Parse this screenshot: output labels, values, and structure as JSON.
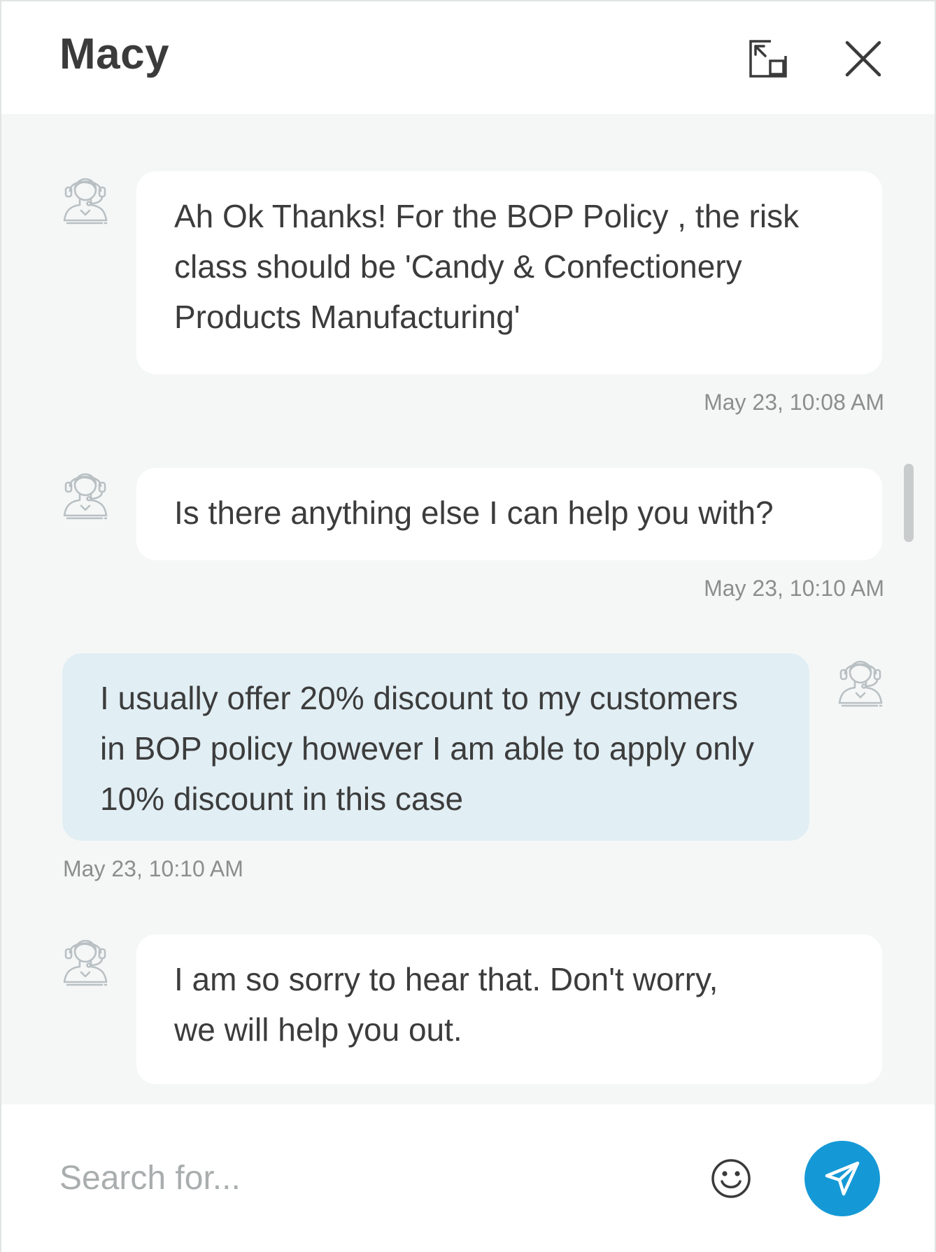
{
  "header": {
    "title": "Macy",
    "expand_icon": "expand-icon",
    "close_icon": "close-icon"
  },
  "messages": [
    {
      "sender": "agent",
      "avatar_icon": "agent-headset-avatar-icon",
      "lines": [
        "Ah Ok Thanks!  For the BOP Policy , the risk",
        "class should be 'Candy & Confectionery",
        "Products Manufacturing'"
      ],
      "timestamp": "May 23, 10:08 AM"
    },
    {
      "sender": "agent",
      "avatar_icon": "agent-headset-avatar-icon",
      "lines": [
        "Is there anything else I can help you with?"
      ],
      "timestamp": "May 23, 10:10 AM"
    },
    {
      "sender": "user",
      "avatar_icon": "user-headset-avatar-icon",
      "lines": [
        "I usually offer 20% discount to my customers",
        "in BOP policy however I am able to apply only",
        "10% discount in this case"
      ],
      "timestamp": "May 23, 10:10 AM"
    },
    {
      "sender": "agent",
      "avatar_icon": "agent-headset-avatar-icon",
      "lines": [
        "I am so sorry to hear that. Don't worry,",
        "we will help you out."
      ],
      "timestamp": ""
    }
  ],
  "composer": {
    "placeholder": "Search for...",
    "value": "",
    "emoji_icon": "smiley-icon",
    "send_icon": "paper-plane-icon"
  },
  "colors": {
    "accent": "#1599d6",
    "messages_background": "#f5f7f7",
    "agent_bubble": "#ffffff",
    "user_bubble": "#e1eef4"
  }
}
